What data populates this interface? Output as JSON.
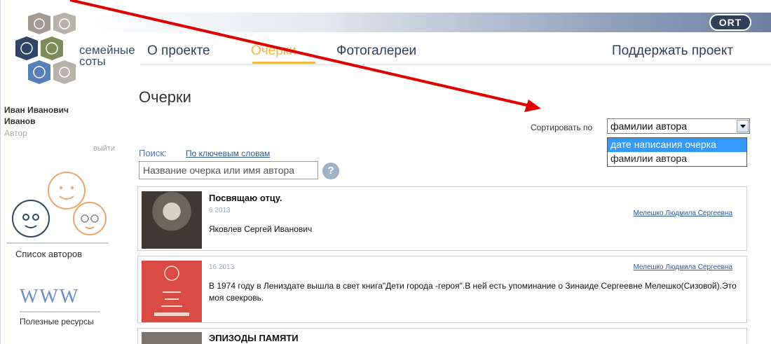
{
  "header": {
    "brand_logo": "ORT"
  },
  "logo": {
    "line1": "семейные",
    "line2": "соты"
  },
  "user": {
    "name_line1": "Иван Иванович",
    "name_line2": "Иванов",
    "role": "Автор",
    "logout": "выйти"
  },
  "sidebar": {
    "authors_label": "Список авторов",
    "www_text": "WWW",
    "resources_label": "Полезные ресурсы"
  },
  "nav": {
    "items": [
      "О проекте",
      "Очерки",
      "Фотогалереи"
    ],
    "active": "Очерки",
    "support": "Поддержать проект"
  },
  "page": {
    "title": "Очерки"
  },
  "sort": {
    "label": "Сортировать по",
    "selected": "фамилии автора",
    "options": [
      "дате написания очерка",
      "фамилии автора"
    ],
    "highlighted": "дате написания очерка"
  },
  "search": {
    "label": "Поиск:",
    "mode_link": "По ключевым словам",
    "placeholder": "Название очерка или имя автора",
    "help": "?"
  },
  "articles": [
    {
      "title": "Посвящаю отцу.",
      "date": "6 2013",
      "author": "Мелешко Людмила Сергеевна",
      "text": "Яковлев Сергей Иванович"
    },
    {
      "title": "",
      "date": "16 2013",
      "author": "Мелешко Людмила Сергеевна",
      "text": "В 1974 году в Лениздате вышла в свет книга\"Дети города -героя\".В ней есть упоминание о Зинаиде Сергеевне Мелешко(Сизовой).Это моя свекровь."
    },
    {
      "title": "ЭПИЗОДЫ ПАМЯТИ",
      "date": "",
      "author": "",
      "text": ""
    }
  ],
  "colors": {
    "nav": "#2f3f5c",
    "active": "#f4b53c",
    "link": "#2a5a9a",
    "annotation": "#e00000",
    "highlight": "#3399ff"
  }
}
